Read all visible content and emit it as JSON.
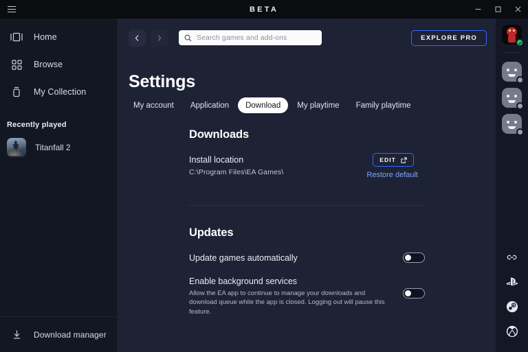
{
  "titlebar": {
    "title": "BETA",
    "menu_icon": "hamburger-icon",
    "minimize_label": "Minimize",
    "maximize_label": "Maximize",
    "close_label": "Close"
  },
  "sidebar": {
    "items": [
      {
        "label": "Home",
        "icon": "home-icon"
      },
      {
        "label": "Browse",
        "icon": "grid-icon"
      },
      {
        "label": "My Collection",
        "icon": "collection-icon"
      }
    ],
    "recently_played_title": "Recently played",
    "recent_games": [
      {
        "label": "Titanfall 2"
      }
    ],
    "footer": {
      "label": "Download manager",
      "icon": "download-icon"
    }
  },
  "topbar": {
    "back_label": "Back",
    "forward_label": "Forward",
    "search": {
      "placeholder": "Search games and add-ons",
      "value": "",
      "icon": "search-icon"
    },
    "explore_pro_label": "EXPLORE PRO"
  },
  "page": {
    "title": "Settings",
    "tabs": [
      {
        "label": "My account",
        "active": false
      },
      {
        "label": "Application",
        "active": false
      },
      {
        "label": "Download",
        "active": true
      },
      {
        "label": "My playtime",
        "active": false
      },
      {
        "label": "Family playtime",
        "active": false
      }
    ]
  },
  "downloads": {
    "heading": "Downloads",
    "install_location_label": "Install location",
    "install_location_value": "C:\\Program Files\\EA Games\\",
    "edit_button_label": "EDIT",
    "edit_button_icon": "external-link-icon",
    "restore_default_label": "Restore default"
  },
  "updates": {
    "heading": "Updates",
    "auto_update": {
      "label": "Update games automatically",
      "state": "off"
    },
    "background_services": {
      "label": "Enable background services",
      "description": "Allow the EA app to continue to manage your downloads and download queue while the app is closed. Logging out will pause this feature.",
      "state": "off"
    }
  },
  "rail": {
    "user_avatar": {
      "name": "user-avatar",
      "status": "online"
    },
    "friends": [
      {
        "name": "friend-avatar-1",
        "status": "offline"
      },
      {
        "name": "friend-avatar-2",
        "status": "offline"
      },
      {
        "name": "friend-avatar-3",
        "status": "offline"
      }
    ],
    "links": [
      {
        "icon": "link-icon",
        "label": "Linked accounts"
      },
      {
        "icon": "playstation-icon",
        "label": "PlayStation"
      },
      {
        "icon": "steam-icon",
        "label": "Steam"
      },
      {
        "icon": "xbox-icon",
        "label": "Xbox"
      }
    ]
  },
  "colors": {
    "accent_blue": "#2f6bff",
    "link_blue": "#7ea4ff",
    "sidebar_bg": "#131722",
    "main_bg": "#1e2235",
    "titlebar_bg": "#0b0c10",
    "rail_bg": "#141826",
    "online_green": "#2ec06a"
  }
}
